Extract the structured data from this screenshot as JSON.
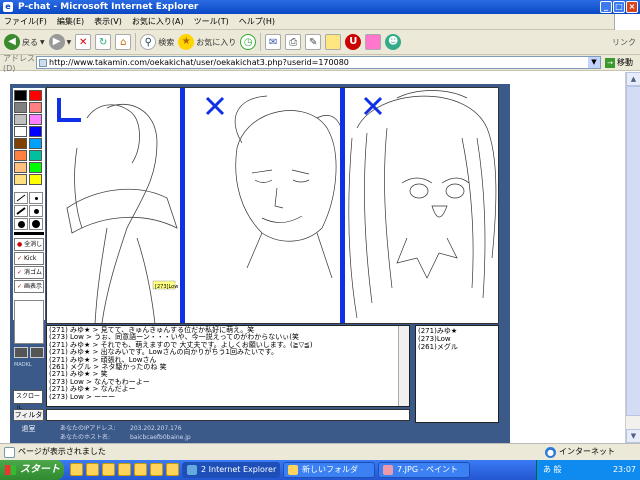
{
  "window": {
    "title": "P-chat - Microsoft Internet Explorer",
    "min": "_",
    "max": "□",
    "close": "×"
  },
  "menu": [
    "ファイル(F)",
    "編集(E)",
    "表示(V)",
    "お気に入り(A)",
    "ツール(T)",
    "ヘルプ(H)"
  ],
  "toolbar": {
    "back": "戻る",
    "search": "検索",
    "favorites": "お気に入り",
    "links": "リンク"
  },
  "address": {
    "label": "アドレス(D)",
    "url": "http://www.takamin.com/oekakichat/user/oekakichat3.php?userid=170080",
    "go": "移動"
  },
  "app": {
    "palette_colors": [
      "#000000",
      "#ff0000",
      "#808080",
      "#ff8080",
      "#c0c0c0",
      "#ff80ff",
      "#ffffff",
      "#0000ff",
      "#804000",
      "#00a0ff",
      "#ff8040",
      "#00c0a0",
      "#ffc080",
      "#00ff00",
      "#ffe080",
      "#ffff00"
    ],
    "tool_buttons": [
      {
        "icon": "●",
        "label": "全消し"
      },
      {
        "icon": "✓",
        "label": "Kick"
      },
      {
        "icon": "✓",
        "label": "消ゴム"
      },
      {
        "icon": "✓",
        "label": "画表示"
      }
    ],
    "madkl": "MADKL",
    "scroll_btn": "スクロール",
    "filter_btn": "フィルタ",
    "leave_btn": "退室",
    "cursor_label": "[273]Low",
    "canvas_marks": [
      "L",
      "✗",
      "✗"
    ],
    "info": {
      "ip_label": "あなたのIPアドレス:",
      "ip_value": "203.202.207.176",
      "host_label": "あなたのホスト名:",
      "host_value": "baicbcaefb0baine.jp"
    }
  },
  "chat": {
    "lines": [
      "(271) みゆ★ > 見てて、きゅんきゅんする位だか私好に萌え。笑",
      "(273) Low > うぉ、同意語ーン・・・いや、今一説えってのがわからないぃ(笑",
      "(271) みゆ★ > それでも、萌えますので 大丈夫です。よしくお願いします。(≧▽≦)",
      "(271) みゆ★ > 出なみいです。Lowさんの向かりがちう1回みたいです。",
      "(271) みゆ★ > 頑張れ、Lowさん",
      "(261) メグル > ネタ駆かったのね 笑",
      "(271) みゆ★ > 笑",
      "(273) Low > なんでもわーよー",
      "(271) みゆ★ > なんだよー",
      "(273) Low > ーーー"
    ]
  },
  "users": [
    "(271)みゆ★",
    "(273)Low",
    "(261)メグル"
  ],
  "status": {
    "text": "ページが表示されました",
    "zone": "インターネット"
  },
  "taskbar": {
    "start": "スタート",
    "tasks": [
      "2 Internet Explorer",
      "新しいフォルダ",
      "7.JPG - ペイント"
    ],
    "ime": "あ 般",
    "clock": "23:07"
  }
}
